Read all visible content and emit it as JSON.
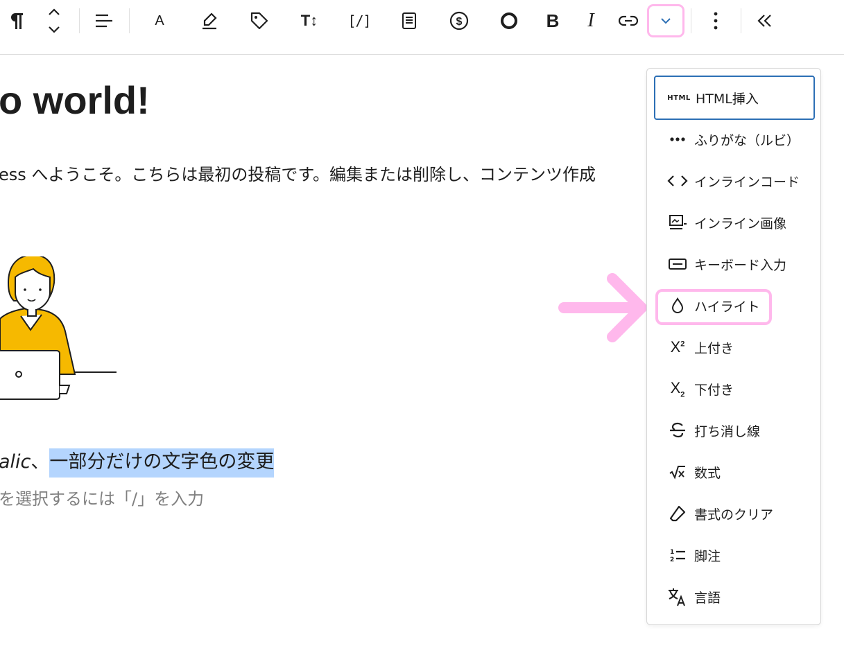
{
  "toolbar": {
    "buttons": [
      {
        "name": "paragraph",
        "icon": "pilcrow-icon"
      },
      {
        "name": "move",
        "icon": "chevron-up-down-icon"
      },
      {
        "name": "align",
        "icon": "align-left-icon"
      },
      {
        "name": "text-color",
        "icon": "letter-a-icon",
        "label": "A"
      },
      {
        "name": "marker",
        "icon": "highlighter-icon"
      },
      {
        "name": "tag",
        "icon": "tag-icon"
      },
      {
        "name": "font-size",
        "icon": "text-size-icon",
        "label": "T↕"
      },
      {
        "name": "shortcode",
        "icon": "shortcode-icon",
        "label": "[/]"
      },
      {
        "name": "document",
        "icon": "document-icon"
      },
      {
        "name": "dollar",
        "icon": "dollar-circle-icon"
      },
      {
        "name": "circle",
        "icon": "circle-icon"
      },
      {
        "name": "bold",
        "icon": "bold-icon",
        "label": "B"
      },
      {
        "name": "italic",
        "icon": "italic-icon",
        "label": "I"
      },
      {
        "name": "link",
        "icon": "link-icon"
      },
      {
        "name": "more-rich-text",
        "icon": "chevron-down-icon"
      },
      {
        "name": "options",
        "icon": "more-vertical-icon"
      },
      {
        "name": "collapse",
        "icon": "chevrons-left-icon"
      }
    ],
    "active_highlight_color": "#ffb8ec"
  },
  "content": {
    "title": "o world!",
    "paragraph": "ess へようこそ。こちらは最初の投稿です。編集または削除し、コンテンツ作成",
    "line3_italic": "alic",
    "line3_comma": "、",
    "line3_selected": "一部分だけの文字色の変更",
    "placeholder": "を選択するには「/」を入力",
    "selection_color": "#b4d5fe"
  },
  "dropdown": {
    "items": [
      {
        "label": "HTML挿入",
        "icon": "html-icon",
        "icon_text": "HTML"
      },
      {
        "label": "ふりがな（ルビ）",
        "icon": "more-horizontal-icon"
      },
      {
        "label": "インラインコード",
        "icon": "code-icon"
      },
      {
        "label": "インライン画像",
        "icon": "image-icon"
      },
      {
        "label": "キーボード入力",
        "icon": "keyboard-icon"
      },
      {
        "label": "ハイライト",
        "icon": "drop-icon"
      },
      {
        "label": "上付き",
        "icon": "superscript-icon"
      },
      {
        "label": "下付き",
        "icon": "subscript-icon"
      },
      {
        "label": "打ち消し線",
        "icon": "strikethrough-icon"
      },
      {
        "label": "数式",
        "icon": "math-icon"
      },
      {
        "label": "書式のクリア",
        "icon": "eraser-icon"
      },
      {
        "label": "脚注",
        "icon": "footnote-icon"
      },
      {
        "label": "言語",
        "icon": "translate-icon"
      }
    ],
    "focus_color": "#2c6fb5"
  },
  "annotation": {
    "arrow_color": "#ffb8ec",
    "highlight_target": "ハイライト"
  }
}
